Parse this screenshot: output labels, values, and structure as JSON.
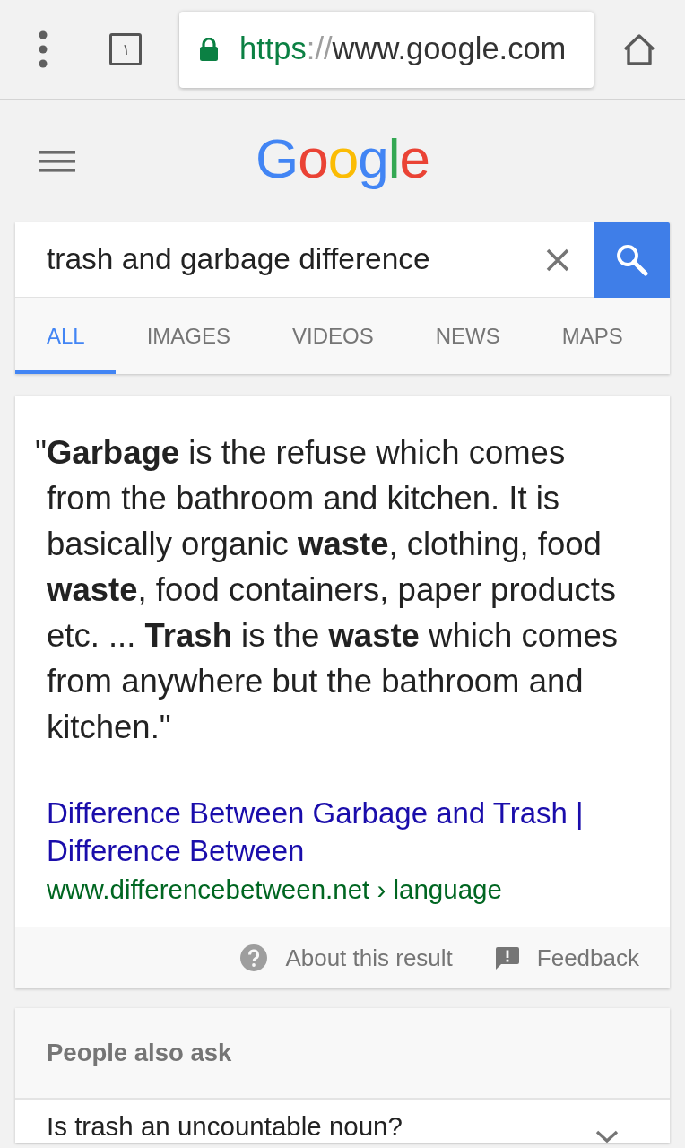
{
  "browser_toolbar": {
    "tab_count": "١",
    "url": {
      "secure": true,
      "scheme": "https",
      "separator": "://",
      "host": "www.google.com"
    }
  },
  "header": {
    "logo": "Google"
  },
  "search": {
    "value": "trash and garbage difference"
  },
  "tabs": [
    {
      "label": "ALL",
      "selected": true
    },
    {
      "label": "IMAGES",
      "selected": false
    },
    {
      "label": "VIDEOS",
      "selected": false
    },
    {
      "label": "NEWS",
      "selected": false
    },
    {
      "label": "MAPS",
      "selected": false
    }
  ],
  "result": {
    "snippet": "\"**Garbage** is the refuse which comes from the bathroom and kitchen. It is basically organic **waste**, clothing, food **waste**, food containers, paper products etc. ... **Trash** is the **waste** which comes from anywhere but the bathroom and kitchen.\"",
    "title": "Difference Between Garbage and Trash | Difference Between",
    "url": "www.differencebetween.net › language",
    "actions": [
      {
        "kind": "about",
        "label": "About this result"
      },
      {
        "kind": "feedback",
        "label": "Feedback"
      }
    ]
  },
  "people_also_ask": {
    "title": "People also ask",
    "questions": [
      {
        "text": "Is trash an uncountable noun?",
        "expanded": false
      }
    ]
  }
}
